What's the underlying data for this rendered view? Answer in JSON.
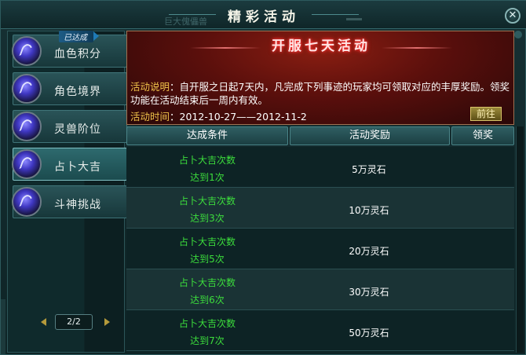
{
  "window": {
    "title": "精彩活动",
    "background_text": "巨大傀儡兽",
    "close_glyph": "✕"
  },
  "sidebar": {
    "items": [
      {
        "label": "血色积分",
        "badge": "已达成",
        "active": false
      },
      {
        "label": "角色境界",
        "active": false
      },
      {
        "label": "灵兽阶位",
        "active": false
      },
      {
        "label": "占卜大吉",
        "active": true
      },
      {
        "label": "斗神挑战",
        "active": false
      }
    ],
    "pager": {
      "text": "2/2",
      "prev_icon": "left-arrow",
      "next_icon": "right-arrow"
    }
  },
  "banner": {
    "title": "开服七天活动",
    "desc_label": "活动说明",
    "desc_text": "：自开服之日起7天内，凡完成下列事迹的玩家均可领取对应的丰厚奖励。领奖功能在活动结束后一周内有效。",
    "time_label": "活动时间",
    "time_text": "：2012-10-27——2012-11-2",
    "go_button": "前往"
  },
  "table": {
    "headers": [
      "达成条件",
      "活动奖励",
      "领奖"
    ],
    "rows": [
      {
        "cond": "占卜大吉次数",
        "target": "达到1次",
        "reward": "5万灵石"
      },
      {
        "cond": "占卜大吉次数",
        "target": "达到3次",
        "reward": "10万灵石"
      },
      {
        "cond": "占卜大吉次数",
        "target": "达到5次",
        "reward": "20万灵石"
      },
      {
        "cond": "占卜大吉次数",
        "target": "达到6次",
        "reward": "30万灵石"
      },
      {
        "cond": "占卜大吉次数",
        "target": "达到7次",
        "reward": "50万灵石"
      }
    ]
  },
  "colors": {
    "condition_text": "#3cde3c",
    "label_gold": "#f0c24a",
    "banner_red": "#5a0f0c"
  }
}
